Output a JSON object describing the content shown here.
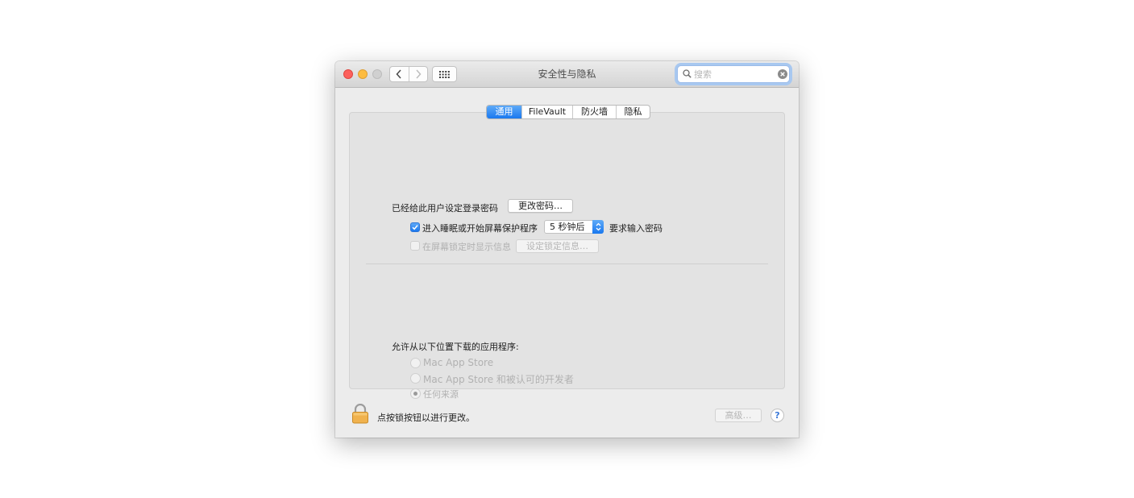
{
  "window": {
    "title": "安全性与隐私",
    "search": {
      "placeholder": "搜索",
      "value": ""
    }
  },
  "tabs": [
    {
      "label": "通用",
      "active": true
    },
    {
      "label": "FileVault",
      "active": false
    },
    {
      "label": "防火墙",
      "active": false
    },
    {
      "label": "隐私",
      "active": false
    }
  ],
  "general": {
    "password_set_label": "已经给此用户设定登录密码",
    "change_password_button": "更改密码…",
    "require_password": {
      "checked": true,
      "label_before": "进入睡眠或开始屏幕保护程序",
      "delay_value": "5 秒钟后",
      "label_after": "要求输入密码"
    },
    "show_message": {
      "checked": false,
      "enabled": false,
      "label": "在屏幕锁定时显示信息",
      "button": "设定锁定信息…"
    }
  },
  "downloads": {
    "heading": "允许从以下位置下载的应用程序:",
    "options": [
      {
        "label": "Mac App Store",
        "selected": false
      },
      {
        "label": "Mac App Store 和被认可的开发者",
        "selected": false
      },
      {
        "label": "任何来源",
        "selected": true
      }
    ],
    "enabled": false
  },
  "footer": {
    "lock_icon": "lock-icon",
    "lock_message": "点按锁按钮以进行更改。",
    "advanced_button": "高级…",
    "help_button": "?"
  },
  "colors": {
    "accent": "#1a78ef",
    "close": "#fc605c",
    "minimize": "#fdbc40",
    "zoom_disabled": "#d0d0d0",
    "lock": "#e8a33a"
  }
}
